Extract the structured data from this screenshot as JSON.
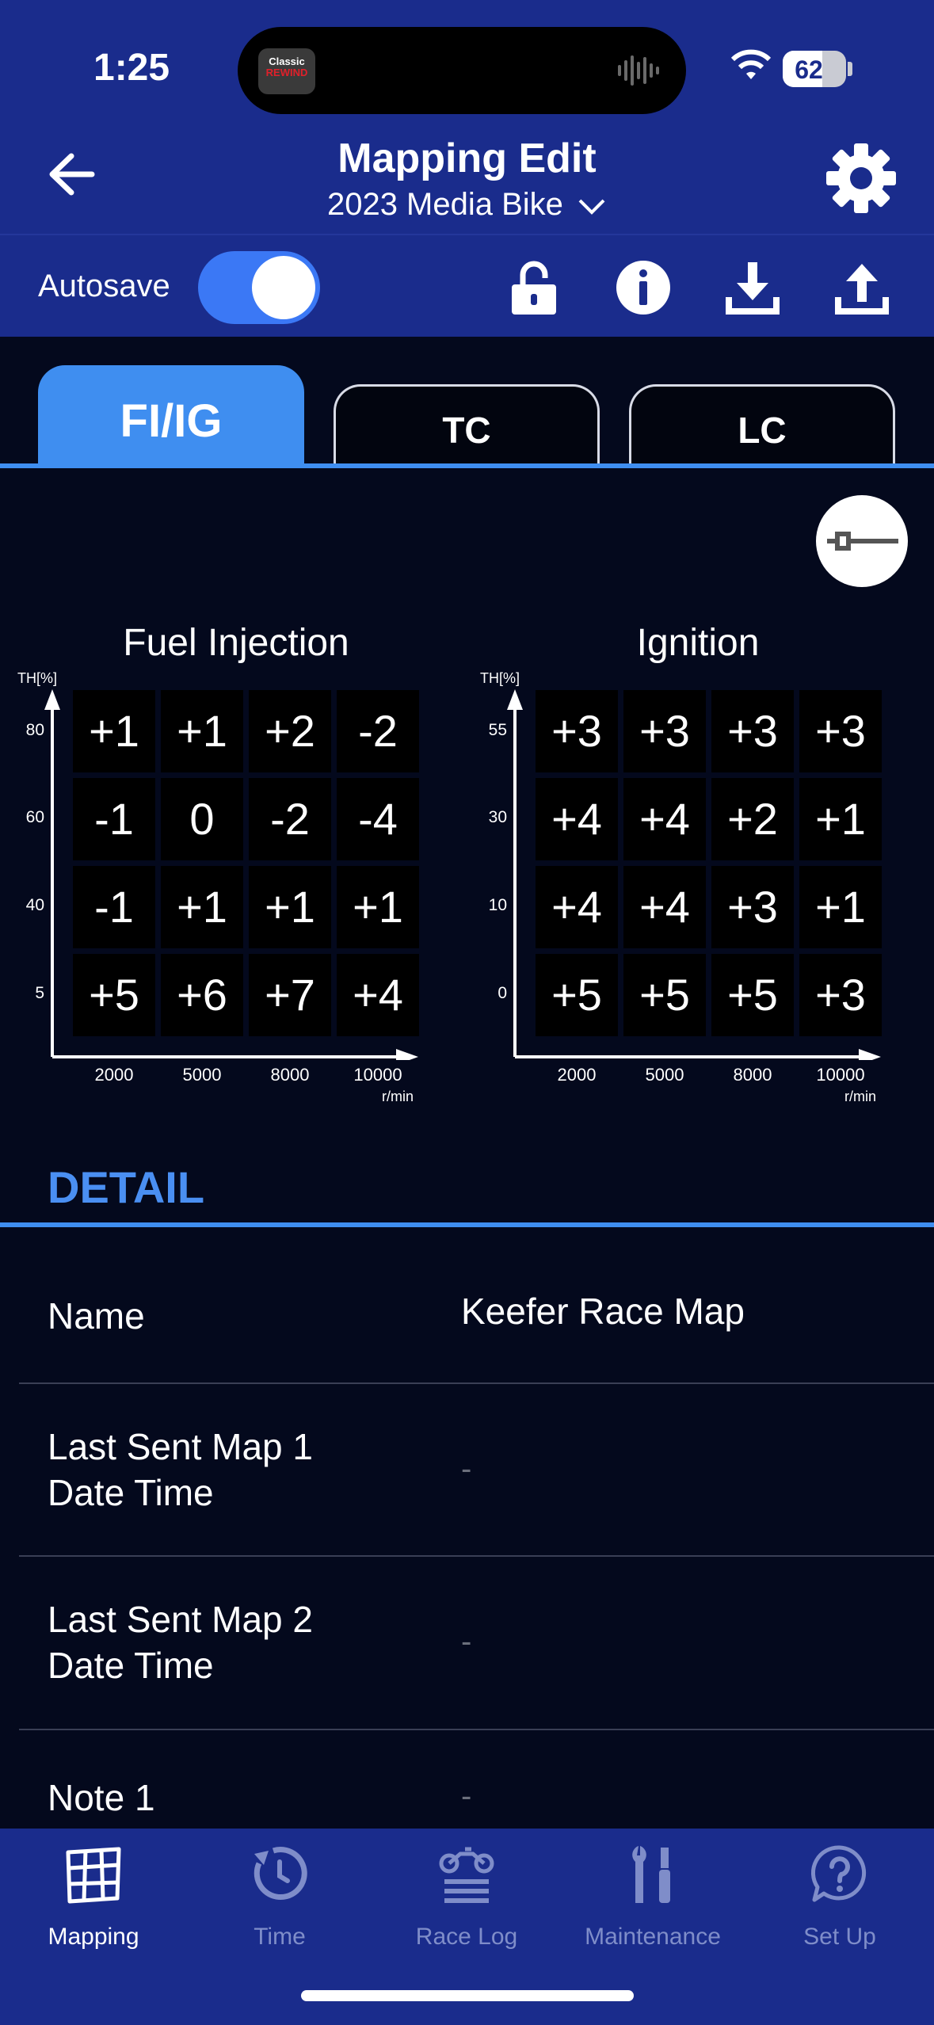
{
  "status": {
    "time": "1:25",
    "battery": "62",
    "island_logo_top": "Classic",
    "island_logo_bottom": "REWIND"
  },
  "header": {
    "title": "Mapping Edit",
    "subtitle": "2023 Media Bike"
  },
  "toolbar": {
    "autosave_label": "Autosave",
    "autosave_on": true
  },
  "tabs": [
    {
      "label": "FI/IG",
      "active": true
    },
    {
      "label": "TC",
      "active": false
    },
    {
      "label": "LC",
      "active": false
    }
  ],
  "fuel_map": {
    "title": "Fuel Injection",
    "y_axis_label": "TH[%]",
    "y_ticks": [
      "80",
      "60",
      "40",
      "5"
    ],
    "x_ticks": [
      "2000",
      "5000",
      "8000",
      "10000"
    ],
    "x_unit": "r/min",
    "rows": [
      [
        "+1",
        "+1",
        "+2",
        "-2"
      ],
      [
        "-1",
        "0",
        "-2",
        "-4"
      ],
      [
        "-1",
        "+1",
        "+1",
        "+1"
      ],
      [
        "+5",
        "+6",
        "+7",
        "+4"
      ]
    ]
  },
  "ignition_map": {
    "title": "Ignition",
    "y_axis_label": "TH[%]",
    "y_ticks": [
      "55",
      "30",
      "10",
      "0"
    ],
    "x_ticks": [
      "2000",
      "5000",
      "8000",
      "10000"
    ],
    "x_unit": "r/min",
    "rows": [
      [
        "+3",
        "+3",
        "+3",
        "+3"
      ],
      [
        "+4",
        "+4",
        "+2",
        "+1"
      ],
      [
        "+4",
        "+4",
        "+3",
        "+1"
      ],
      [
        "+5",
        "+5",
        "+5",
        "+3"
      ]
    ]
  },
  "detail": {
    "heading": "DETAIL",
    "rows": [
      {
        "label": "Name",
        "value": "Keefer Race Map"
      },
      {
        "label_1": "Last Sent Map 1",
        "label_2": "Date Time",
        "value": "-"
      },
      {
        "label_1": "Last Sent Map 2",
        "label_2": "Date Time",
        "value": "-"
      },
      {
        "label": "Note 1",
        "value": "-"
      }
    ]
  },
  "nav": [
    {
      "label": "Mapping",
      "icon": "map-grid-icon",
      "active": true
    },
    {
      "label": "Time",
      "icon": "stopwatch-icon",
      "active": false
    },
    {
      "label": "Race Log",
      "icon": "motorcycle-icon",
      "active": false
    },
    {
      "label": "Maintenance",
      "icon": "tools-icon",
      "active": false
    },
    {
      "label": "Set Up",
      "icon": "help-bubble-icon",
      "active": false
    }
  ]
}
